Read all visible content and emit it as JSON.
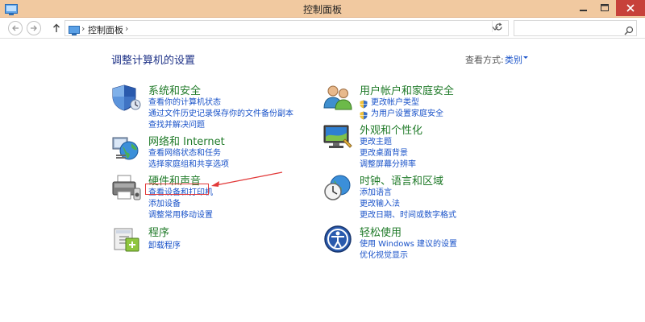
{
  "window": {
    "title": "控制面板"
  },
  "addressbar": {
    "path": "控制面板",
    "search_placeholder": ""
  },
  "main": {
    "heading": "调整计算机的设置",
    "view_by_label": "查看方式:",
    "view_by_value": "类别"
  },
  "categories": [
    {
      "title": "系统和安全",
      "links": [
        "查看你的计算机状态",
        "通过文件历史记录保存你的文件备份副本",
        "查找并解决问题"
      ]
    },
    {
      "title": "网络和 Internet",
      "links": [
        "查看网络状态和任务",
        "选择家庭组和共享选项"
      ]
    },
    {
      "title": "硬件和声音",
      "links": [
        "查看设备和打印机",
        "添加设备",
        "调整常用移动设置"
      ]
    },
    {
      "title": "程序",
      "links": [
        "卸载程序"
      ]
    },
    {
      "title": "用户帐户和家庭安全",
      "links": [
        "更改帐户类型",
        "为用户设置家庭安全"
      ]
    },
    {
      "title": "外观和个性化",
      "links": [
        "更改主题",
        "更改桌面背景",
        "调整屏幕分辨率"
      ]
    },
    {
      "title": "时钟、语言和区域",
      "links": [
        "添加语言",
        "更改输入法",
        "更改日期、时间或数字格式"
      ]
    },
    {
      "title": "轻松使用",
      "links": [
        "使用 Windows 建议的设置",
        "优化视觉显示"
      ]
    }
  ],
  "colors": {
    "titlebar": "#f1c9a0",
    "close_button": "#c7413a",
    "category_title": "#1f7a28",
    "link": "#1a53c9",
    "heading": "#1e3287",
    "annotation": "#e23a3a"
  }
}
